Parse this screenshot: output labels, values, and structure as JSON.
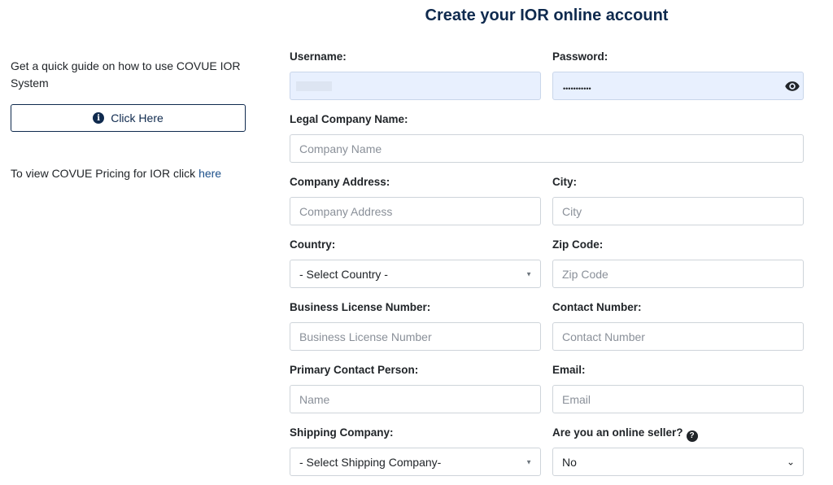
{
  "sidebar": {
    "guide_text": "Get a quick guide on how to use COVUE IOR System",
    "guide_button_label": "Click Here",
    "pricing_text": "To view COVUE Pricing for IOR click ",
    "pricing_link": "here"
  },
  "form": {
    "title": "Create your IOR online account",
    "username_label": "Username:",
    "password_label": "Password:",
    "password_mask": "•••••••••••",
    "legal_company_label": "Legal Company Name:",
    "legal_company_placeholder": "Company Name",
    "company_address_label": "Company Address:",
    "company_address_placeholder": "Company Address",
    "city_label": "City:",
    "city_placeholder": "City",
    "country_label": "Country:",
    "country_value": "- Select Country -",
    "zip_label": "Zip Code:",
    "zip_placeholder": "Zip Code",
    "license_label": "Business License Number:",
    "license_placeholder": "Business License Number",
    "contact_number_label": "Contact Number:",
    "contact_number_placeholder": "Contact Number",
    "primary_contact_label": "Primary Contact Person:",
    "primary_contact_placeholder": "Name",
    "email_label": "Email:",
    "email_placeholder": "Email",
    "shipping_label": "Shipping Company:",
    "shipping_value": "- Select Shipping Company-",
    "online_seller_label": "Are you an online seller?",
    "online_seller_value": "No"
  },
  "icons": {
    "info": "info-circle-icon",
    "eye": "eye-icon",
    "help": "question-circle-icon",
    "caret": "caret-down-icon",
    "chevron": "chevron-down-icon"
  },
  "colors": {
    "brand": "#0f2a4e",
    "autofill": "#e8f0fe",
    "link": "#1b4f8a"
  }
}
